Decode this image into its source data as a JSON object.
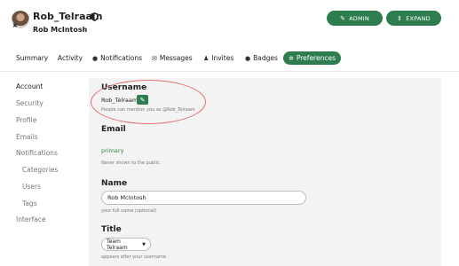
{
  "header": {
    "username": "Rob_Telraam",
    "full_name": "Rob McIntosh",
    "admin_label": "ADMIN",
    "expand_label": "EXPAND"
  },
  "nav": {
    "tabs": [
      {
        "label": "Summary",
        "icon": ""
      },
      {
        "label": "Activity",
        "icon": ""
      },
      {
        "label": "Notifications",
        "icon": "comment-icon"
      },
      {
        "label": "Messages",
        "icon": "envelope-icon"
      },
      {
        "label": "Invites",
        "icon": "user-plus-icon"
      },
      {
        "label": "Badges",
        "icon": "badge-icon"
      },
      {
        "label": "Preferences",
        "icon": "gear-icon",
        "active": true
      }
    ]
  },
  "sidebar": {
    "items": [
      {
        "label": "Account",
        "active": true
      },
      {
        "label": "Security"
      },
      {
        "label": "Profile"
      },
      {
        "label": "Emails"
      },
      {
        "label": "Notifications"
      },
      {
        "label": "Categories",
        "sub": true
      },
      {
        "label": "Users",
        "sub": true
      },
      {
        "label": "Tags",
        "sub": true
      },
      {
        "label": "Interface"
      }
    ]
  },
  "form": {
    "username_label": "Username",
    "username_value": "Rob_Telraam",
    "username_help": "People can mention you as @Rob_Telraam",
    "email_label": "Email",
    "email_value": "primary",
    "email_help": "Never shown to the public.",
    "name_label": "Name",
    "name_value": "Rob McIntosh",
    "name_help": "your full name (optional)",
    "title_label": "Title",
    "title_value": "Team Telraam",
    "title_help": "appears after your username"
  },
  "colors": {
    "accent": "#2e7d4f",
    "email_text": "#2e8b3a",
    "annotation": "#e07070"
  }
}
